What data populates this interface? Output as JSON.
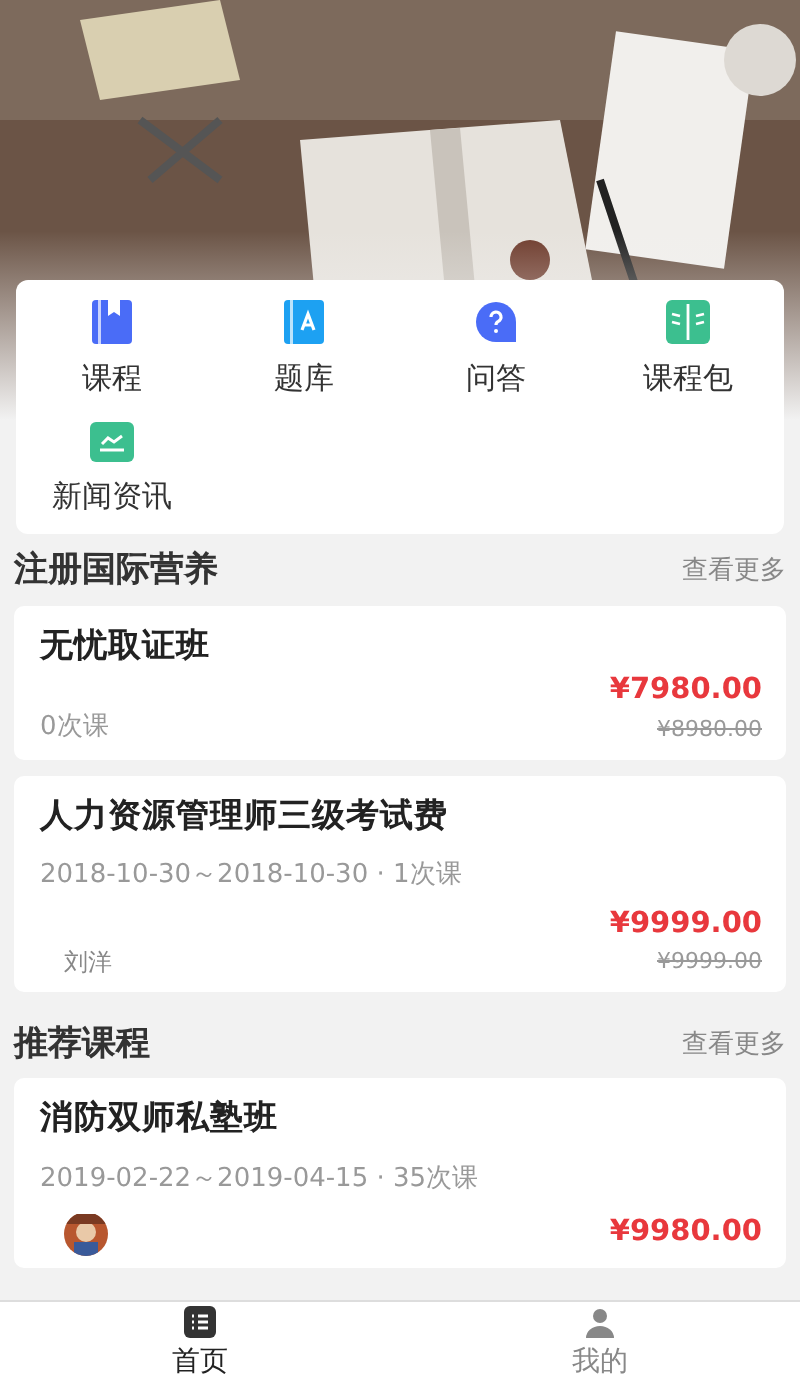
{
  "shortcuts": [
    {
      "label": "课程",
      "kind": "book"
    },
    {
      "label": "题库",
      "kind": "bank"
    },
    {
      "label": "问答",
      "kind": "question"
    },
    {
      "label": "课程包",
      "kind": "openbook"
    },
    {
      "label": "新闻资讯",
      "kind": "news"
    }
  ],
  "sections": [
    {
      "title": "注册国际营养",
      "more": "查看更多",
      "courses": [
        {
          "title": "无忧取证班",
          "meta": "0次课",
          "price": "¥7980.00",
          "original_price": "¥8980.00"
        },
        {
          "title": "人力资源管理师三级考试费",
          "meta": "2018-10-30～2018-10-30 · 1次课",
          "teacher": {
            "kind": "name",
            "name": "刘洋"
          },
          "price": "¥9999.00",
          "original_price": "¥9999.00"
        }
      ]
    },
    {
      "title": "推荐课程",
      "more": "查看更多",
      "courses": [
        {
          "title": "消防双师私塾班",
          "meta": "2019-02-22～2019-04-15 · 35次课",
          "teacher": {
            "kind": "avatar"
          },
          "price": "¥9980.00"
        }
      ]
    }
  ],
  "tabbar": [
    {
      "label": "首页",
      "kind": "home",
      "selected": true
    },
    {
      "label": "我的",
      "kind": "profile",
      "selected": false
    }
  ]
}
